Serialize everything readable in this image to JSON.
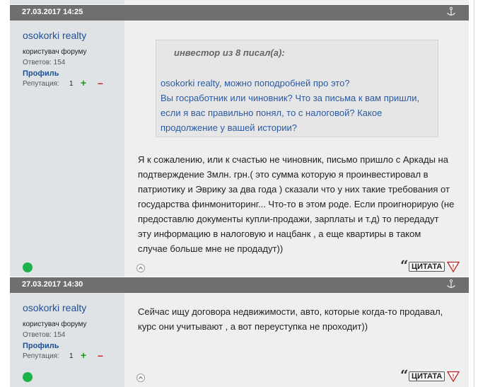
{
  "posts": [
    {
      "date": "27.03.2017 14:25",
      "author": {
        "name": "osokorki realty",
        "role": "користувач форуму",
        "answers": "Ответов: 154",
        "profile": "Профиль",
        "reputation_label": "Репутация:",
        "reputation_value": "1",
        "plus": "+",
        "minus": "–"
      },
      "quote": {
        "author_line": "инвестор из 8 писал(а):",
        "lines": [
          "osokorki realty, можно поподробней про это?",
          "Вы госработник или чиновник? Что за письма к вам пришли,",
          "если я вас правильно понял, то с налоговой? Какое",
          "продолжение у вашей истории?"
        ]
      },
      "text_lines": [
        "Я к сожалению, или к счастью не чиновник, письмо пришло с Аркады на",
        "подтверждение 3млн. грн.( это сумма которую я проинвестировал в",
        "патриотику и Эврику за два года ) сказали что у них такие требования от",
        "государства финмониторинг... Что-то в этом роде. Если проигнорирую (не",
        "предоставлю документы купли-продажи, зарплаты и т.д) то передадут",
        "эту информацию в налоговую и нацбанк , а еще квартиры в таком",
        "случае больше мне не продадут))"
      ],
      "quote_button": "ЦИТАТА"
    },
    {
      "date": "27.03.2017 14:30",
      "author": {
        "name": "osokorki realty",
        "role": "користувач форуму",
        "answers": "Ответов: 154",
        "profile": "Профиль",
        "reputation_label": "Репутация:",
        "reputation_value": "1",
        "plus": "+",
        "minus": "–"
      },
      "text_lines": [
        "Сейчас ищу договора недвижимости, авто, которые когда-то продавал,",
        "курс они учитывают , а вот переуступка не проходит))"
      ],
      "quote_button": "ЦИТАТА"
    }
  ],
  "colors": {
    "header_bg": "#6f6f6f",
    "author_bg": "#dfe3e6",
    "content_bg": "#efefef",
    "link": "#1f4f95",
    "quote_text": "#2a5aa3",
    "online": "#1fb14a"
  },
  "icons": [
    "anchor-icon",
    "online-status-icon",
    "back-to-top-icon",
    "quote-icon",
    "report-icon"
  ]
}
